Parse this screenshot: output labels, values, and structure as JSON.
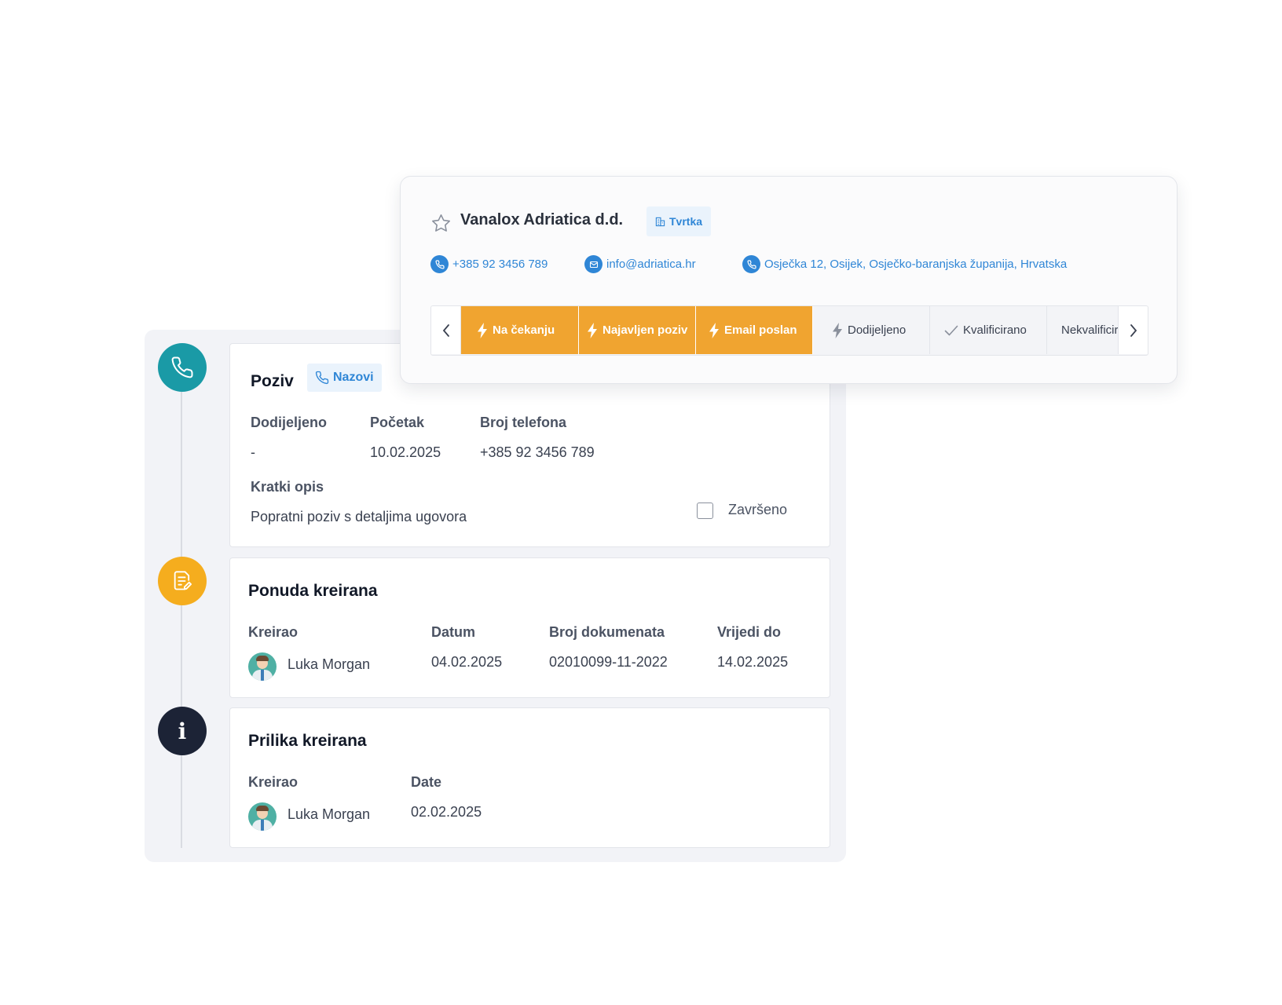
{
  "company": {
    "name": "Vanalox Adriatica d.d.",
    "type_tag": "Tvrtka",
    "phone": "+385 92 3456 789",
    "email": "info@adriatica.hr",
    "address": "Osječka 12, Osijek, Osječko-baranjska županija, Hrvatska",
    "stages": [
      {
        "label": "Na čekanju",
        "active": true,
        "icon": "bolt-icon"
      },
      {
        "label": "Najavljen poziv",
        "active": true,
        "icon": "bolt-icon"
      },
      {
        "label": "Email poslan",
        "active": true,
        "icon": "bolt-icon"
      },
      {
        "label": "Dodijeljeno",
        "active": false,
        "icon": "bolt-icon"
      },
      {
        "label": "Kvalificirano",
        "active": false,
        "icon": "check-icon"
      },
      {
        "label": "Nekvalificirano",
        "active": false,
        "icon": "x-icon"
      }
    ]
  },
  "call": {
    "title": "Poziv",
    "call_button": "Nazovi",
    "assigned_label": "Dodijeljeno",
    "assigned_value": "-",
    "start_label": "Početak",
    "start_value": "10.02.2025",
    "phone_label": "Broj telefona",
    "phone_value": "+385 92 3456 789",
    "desc_label": "Kratki opis",
    "desc_value": "Popratni poziv s detaljima ugovora",
    "done_label": "Završeno",
    "done_checked": false
  },
  "offer": {
    "title": "Ponuda kreirana",
    "created_by_label": "Kreirao",
    "created_by_value": "Luka Morgan",
    "date_label": "Datum",
    "date_value": "04.02.2025",
    "doc_label": "Broj dokumenata",
    "doc_value": "02010099-11-2022",
    "valid_label": "Vrijedi do",
    "valid_value": "14.02.2025"
  },
  "opportunity": {
    "title": "Prilika kreirana",
    "created_by_label": "Kreirao",
    "created_by_value": "Luka Morgan",
    "date_label": "Date",
    "date_value": "02.02.2025"
  },
  "colors": {
    "accent_blue": "#2f86d6",
    "stage_active": "#f0a430",
    "call_icon_bg": "#1a9aa6",
    "offer_icon_bg": "#f5ad1e",
    "info_icon_bg": "#1c2336"
  }
}
